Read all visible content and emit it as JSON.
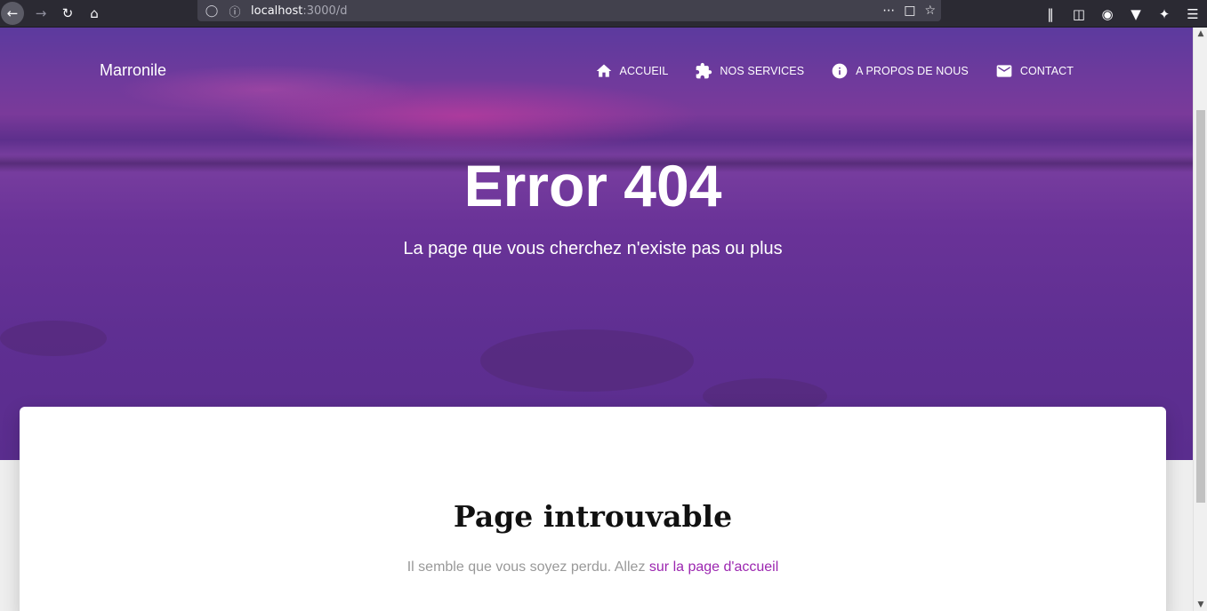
{
  "browser": {
    "url_host": "localhost",
    "url_path": ":3000/d"
  },
  "site": {
    "brand": "Marronile",
    "nav": [
      {
        "label": "ACCUEIL",
        "icon": "home-icon"
      },
      {
        "label": "NOS SERVICES",
        "icon": "puzzle-icon"
      },
      {
        "label": "A PROPOS DE NOUS",
        "icon": "info-icon"
      },
      {
        "label": "CONTACT",
        "icon": "mail-icon"
      }
    ]
  },
  "hero": {
    "title": "Error 404",
    "subtitle": "La page que vous cherchez n'existe pas ou plus"
  },
  "card": {
    "title": "Page introuvable",
    "text": "Il semble que vous soyez perdu. Allez ",
    "link": "sur la page d'accueil"
  },
  "colors": {
    "hero_purple": "#5f2f92",
    "link": "#9c27b0",
    "chrome": "#2b2a33"
  }
}
